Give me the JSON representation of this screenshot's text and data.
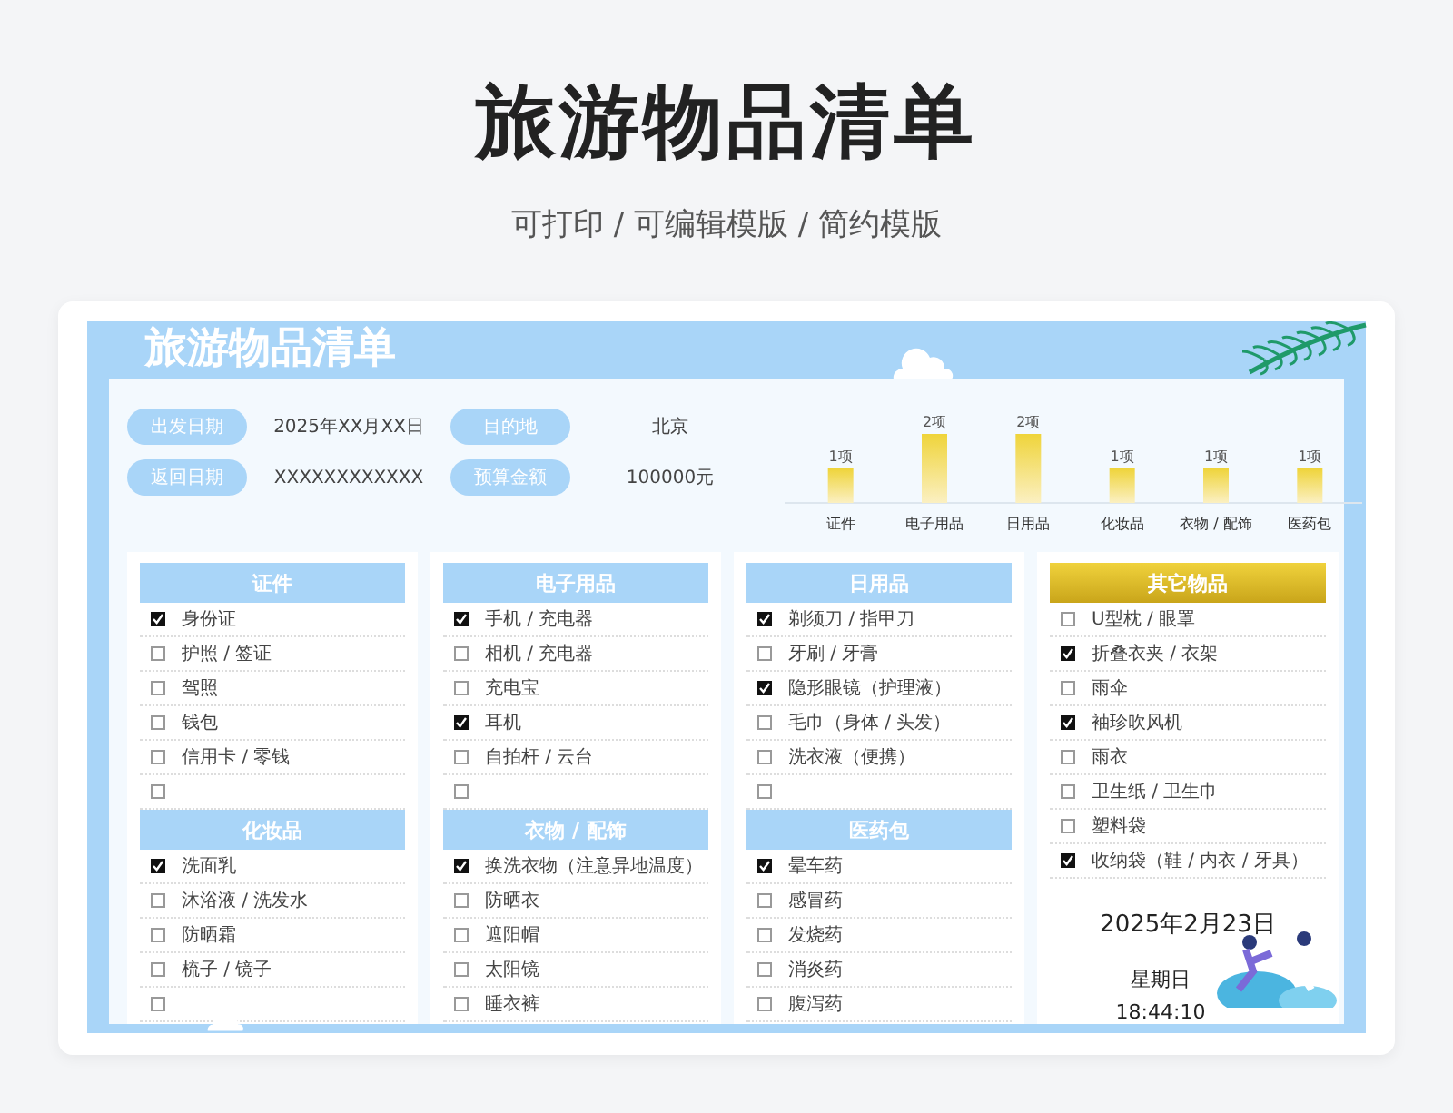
{
  "page_title": "旅游物品清单",
  "subtitle": "可打印 / 可编辑模版 / 简约模版",
  "sheet_title": "旅游物品清单",
  "info": [
    {
      "label": "出发日期",
      "value": "2025年XX月XX日"
    },
    {
      "label": "目的地",
      "value": "北京"
    },
    {
      "label": "返回日期",
      "value": "XXXXXXXXXXXX"
    },
    {
      "label": "预算金额",
      "value": "100000元"
    }
  ],
  "chart_data": {
    "type": "bar",
    "categories": [
      "证件",
      "电子用品",
      "日用品",
      "化妆品",
      "衣物 / 配饰",
      "医药包"
    ],
    "values": [
      1,
      2,
      2,
      1,
      1,
      1
    ],
    "value_labels": [
      "1项",
      "2项",
      "2项",
      "1项",
      "1项",
      "1项"
    ]
  },
  "columns": [
    {
      "sections": [
        {
          "title": "证件",
          "highlight": false,
          "items": [
            {
              "label": "身份证",
              "checked": true
            },
            {
              "label": "护照 / 签证",
              "checked": false
            },
            {
              "label": "驾照",
              "checked": false
            },
            {
              "label": "钱包",
              "checked": false
            },
            {
              "label": "信用卡 / 零钱",
              "checked": false
            },
            {
              "checked": false
            }
          ]
        },
        {
          "title": "化妆品",
          "highlight": false,
          "items": [
            {
              "label": "洗面乳",
              "checked": true
            },
            {
              "label": "沐浴液 / 洗发水",
              "checked": false
            },
            {
              "label": "防晒霜",
              "checked": false
            },
            {
              "label": "梳子 / 镜子",
              "checked": false
            },
            {
              "checked": false
            }
          ]
        }
      ]
    },
    {
      "sections": [
        {
          "title": "电子用品",
          "highlight": false,
          "items": [
            {
              "label": "手机 / 充电器",
              "checked": true
            },
            {
              "label": "相机 / 充电器",
              "checked": false
            },
            {
              "label": "充电宝",
              "checked": false
            },
            {
              "label": "耳机",
              "checked": true
            },
            {
              "label": "自拍杆 / 云台",
              "checked": false
            },
            {
              "checked": false
            }
          ]
        },
        {
          "title": "衣物 / 配饰",
          "highlight": false,
          "items": [
            {
              "label": "换洗衣物（注意异地温度）",
              "checked": true
            },
            {
              "label": "防晒衣",
              "checked": false
            },
            {
              "label": "遮阳帽",
              "checked": false
            },
            {
              "label": "太阳镜",
              "checked": false
            },
            {
              "label": "睡衣裤",
              "checked": false
            }
          ]
        }
      ]
    },
    {
      "sections": [
        {
          "title": "日用品",
          "highlight": false,
          "items": [
            {
              "label": "剃须刀 / 指甲刀",
              "checked": true
            },
            {
              "label": "牙刷 / 牙膏",
              "checked": false
            },
            {
              "label": "隐形眼镜（护理液）",
              "checked": true
            },
            {
              "label": "毛巾（身体 / 头发）",
              "checked": false
            },
            {
              "label": "洗衣液（便携）",
              "checked": false
            },
            {
              "checked": false
            }
          ]
        },
        {
          "title": "医药包",
          "highlight": false,
          "items": [
            {
              "label": "晕车药",
              "checked": true
            },
            {
              "label": "感冒药",
              "checked": false
            },
            {
              "label": "发烧药",
              "checked": false
            },
            {
              "label": "消炎药",
              "checked": false
            },
            {
              "label": "腹泻药",
              "checked": false
            }
          ]
        }
      ]
    },
    {
      "sections": [
        {
          "title": "其它物品",
          "highlight": true,
          "items": [
            {
              "label": "U型枕 / 眼罩",
              "checked": false
            },
            {
              "label": "折叠衣夹 / 衣架",
              "checked": true
            },
            {
              "label": "雨伞",
              "checked": false
            },
            {
              "label": "袖珍吹风机",
              "checked": true
            },
            {
              "label": "雨衣",
              "checked": false
            },
            {
              "label": "卫生纸 / 卫生巾",
              "checked": false
            },
            {
              "label": "塑料袋",
              "checked": false
            },
            {
              "label": "收纳袋（鞋 / 内衣 / 牙具）",
              "checked": true
            }
          ]
        }
      ]
    }
  ],
  "clock": {
    "date": "2025年2月23日",
    "weekday": "星期日",
    "time": "18:44:10"
  }
}
